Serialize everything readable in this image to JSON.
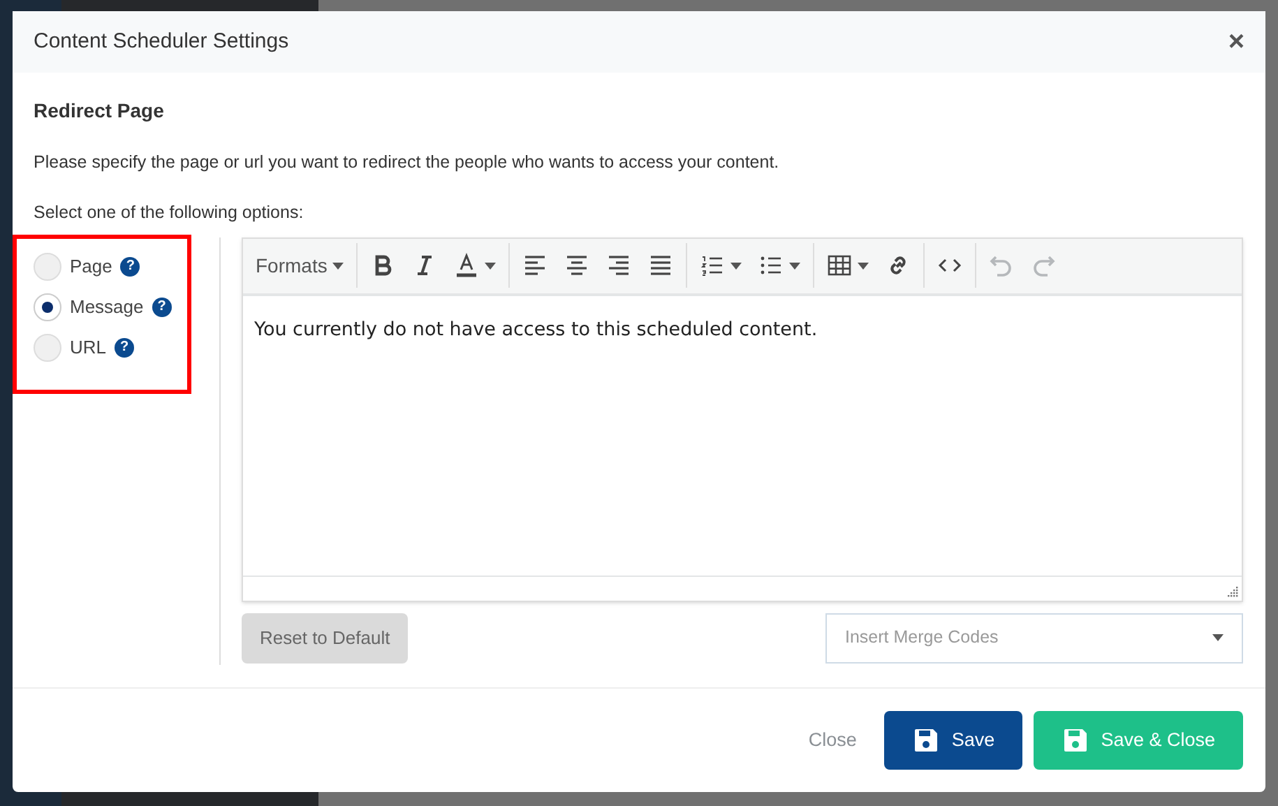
{
  "dialog": {
    "title": "Content Scheduler Settings",
    "close_glyph": "×"
  },
  "section": {
    "heading": "Redirect Page",
    "description": "Please specify the page or url you want to redirect the people who wants to access your content.",
    "prompt": "Select one of the following options:"
  },
  "options": [
    {
      "label": "Page",
      "selected": false,
      "help_glyph": "?"
    },
    {
      "label": "Message",
      "selected": true,
      "help_glyph": "?"
    },
    {
      "label": "URL",
      "selected": false,
      "help_glyph": "?"
    }
  ],
  "editor": {
    "toolbar": [
      [
        {
          "kind": "formats",
          "label": "Formats",
          "dropdown": true,
          "disabled": false
        }
      ],
      [
        {
          "kind": "bold",
          "dropdown": false,
          "disabled": false
        },
        {
          "kind": "italic",
          "dropdown": false,
          "disabled": false
        },
        {
          "kind": "text-color",
          "dropdown": true,
          "disabled": false
        }
      ],
      [
        {
          "kind": "align-left",
          "dropdown": false,
          "disabled": false
        },
        {
          "kind": "align-center",
          "dropdown": false,
          "disabled": false
        },
        {
          "kind": "align-right",
          "dropdown": false,
          "disabled": false
        },
        {
          "kind": "justify",
          "dropdown": false,
          "disabled": false
        }
      ],
      [
        {
          "kind": "numbered-list",
          "dropdown": true,
          "disabled": false
        },
        {
          "kind": "bullet-list",
          "dropdown": true,
          "disabled": false
        }
      ],
      [
        {
          "kind": "table",
          "dropdown": true,
          "disabled": false
        },
        {
          "kind": "link",
          "dropdown": false,
          "disabled": false
        }
      ],
      [
        {
          "kind": "code",
          "dropdown": false,
          "disabled": false
        }
      ],
      [
        {
          "kind": "undo",
          "dropdown": false,
          "disabled": true
        },
        {
          "kind": "redo",
          "dropdown": false,
          "disabled": true
        }
      ]
    ],
    "content": "You currently do not have access to this scheduled content."
  },
  "reset_button": "Reset to Default",
  "merge_codes": {
    "placeholder": "Insert Merge Codes"
  },
  "footer": [
    {
      "kind": "link",
      "label": "Close"
    },
    {
      "kind": "primary",
      "label": "Save"
    },
    {
      "kind": "success",
      "label": "Save & Close"
    }
  ]
}
